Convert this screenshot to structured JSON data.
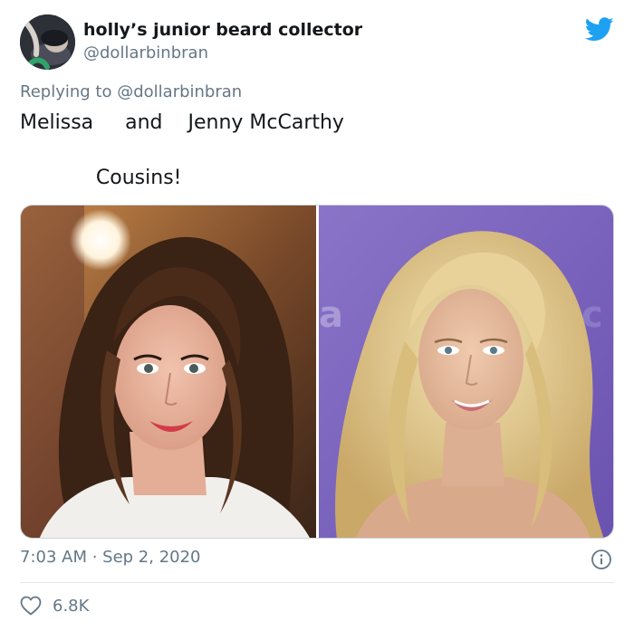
{
  "author": {
    "display_name": "holly’s junior beard collector",
    "handle": "@dollarbinbran"
  },
  "reply": {
    "prefix": "Replying to",
    "to_handle": "@dollarbinbran"
  },
  "tweet": {
    "line1": "Melissa     and    Jenny McCarthy",
    "line2": "            Cousins!"
  },
  "meta": {
    "timestamp": "7:03 AM · Sep 2, 2020",
    "likes": "6.8K"
  },
  "colors": {
    "twitter_blue": "#1da1f2",
    "secondary_text": "#657786"
  },
  "icons": [
    "twitter-bird-icon",
    "info-icon",
    "heart-icon"
  ]
}
